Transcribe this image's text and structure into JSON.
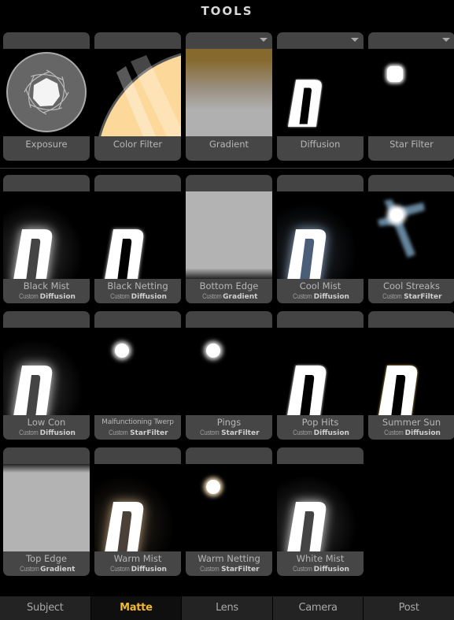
{
  "header": {
    "title": "TOOLS"
  },
  "tools": [
    {
      "name": "Exposure",
      "preview": "aperture-icon",
      "dropdown": false
    },
    {
      "name": "Color Filter",
      "preview": "color-filter-preview",
      "dropdown": false,
      "color": "#fcd99a"
    },
    {
      "name": "Gradient",
      "preview": "gradient-preview",
      "dropdown": true,
      "colors": [
        "#86692c",
        "#b0b0b0"
      ]
    },
    {
      "name": "Diffusion",
      "preview": "diffusion-d-preview",
      "dropdown": true
    },
    {
      "name": "Star Filter",
      "preview": "star-filter-preview",
      "dropdown": true
    }
  ],
  "presets": [
    {
      "name": "Black Mist",
      "prefix": "Custom",
      "type": "Diffusion",
      "preview": "d-glow",
      "glow": "#ffffff"
    },
    {
      "name": "Black Netting",
      "prefix": "Custom",
      "type": "Diffusion",
      "preview": "d-soft",
      "glow": "#cccccc"
    },
    {
      "name": "Bottom Edge",
      "prefix": "Custom",
      "type": "Gradient",
      "preview": "bottom-edge",
      "color": "#b3b3b3"
    },
    {
      "name": "Cool Mist",
      "prefix": "Custom",
      "type": "Diffusion",
      "preview": "d-glow",
      "glow": "#a9c4e6"
    },
    {
      "name": "Cool Streaks",
      "prefix": "Custom",
      "type": "StarFilter",
      "preview": "star-streaks",
      "glow": "#7fa6c4"
    },
    {
      "name": "Low Con",
      "prefix": "Custom",
      "type": "Diffusion",
      "preview": "d-glow",
      "glow": "#ffffff"
    },
    {
      "name": "Malfunctioning Twerp",
      "prefix": "Custom",
      "type": "StarFilter",
      "preview": "spot",
      "glow": "#ffffff"
    },
    {
      "name": "Pings",
      "prefix": "Custom",
      "type": "StarFilter",
      "preview": "spot",
      "glow": "#ffffff"
    },
    {
      "name": "Pop Hits",
      "prefix": "Custom",
      "type": "Diffusion",
      "preview": "d-tight",
      "glow": "#ffffff"
    },
    {
      "name": "Summer Sun",
      "prefix": "Custom",
      "type": "Diffusion",
      "preview": "d-tight",
      "glow": "#e0b860"
    },
    {
      "name": "Top Edge",
      "prefix": "Custom",
      "type": "Gradient",
      "preview": "top-edge",
      "color": "#b3b3b3"
    },
    {
      "name": "Warm Mist",
      "prefix": "Custom",
      "type": "Diffusion",
      "preview": "d-glow",
      "glow": "#d8b890"
    },
    {
      "name": "Warm Netting",
      "prefix": "Custom",
      "type": "StarFilter",
      "preview": "spot-warm",
      "glow": "#f0d8b0"
    },
    {
      "name": "White Mist",
      "prefix": "Custom",
      "type": "Diffusion",
      "preview": "d-glow",
      "glow": "#ffffff"
    }
  ],
  "tabs": [
    {
      "label": "Subject",
      "active": false
    },
    {
      "label": "Matte",
      "active": true
    },
    {
      "label": "Lens",
      "active": false
    },
    {
      "label": "Camera",
      "active": false
    },
    {
      "label": "Post",
      "active": false
    }
  ],
  "colors": {
    "accent": "#f0b830",
    "card": "#464646",
    "background": "#000000"
  }
}
